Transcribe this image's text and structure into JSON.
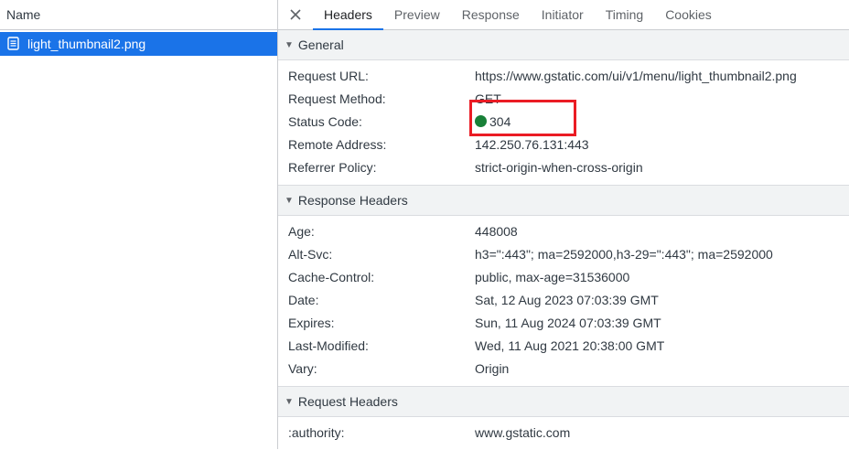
{
  "left": {
    "column_header": "Name",
    "request": {
      "name": "light_thumbnail2.png",
      "icon": "document-icon"
    }
  },
  "tabs": [
    "Headers",
    "Preview",
    "Response",
    "Initiator",
    "Timing",
    "Cookies"
  ],
  "active_tab": "Headers",
  "sections": {
    "general": {
      "title": "General",
      "rows": [
        {
          "key": "Request URL:",
          "value": "https://www.gstatic.com/ui/v1/menu/light_thumbnail2.png"
        },
        {
          "key": "Request Method:",
          "value": "GET"
        },
        {
          "key": "Status Code:",
          "value": "304"
        },
        {
          "key": "Remote Address:",
          "value": "142.250.76.131:443"
        },
        {
          "key": "Referrer Policy:",
          "value": "strict-origin-when-cross-origin"
        }
      ]
    },
    "response_headers": {
      "title": "Response Headers",
      "rows": [
        {
          "key": "Age:",
          "value": "448008"
        },
        {
          "key": "Alt-Svc:",
          "value": "h3=\":443\"; ma=2592000,h3-29=\":443\"; ma=2592000"
        },
        {
          "key": "Cache-Control:",
          "value": "public, max-age=31536000"
        },
        {
          "key": "Date:",
          "value": "Sat, 12 Aug 2023 07:03:39 GMT"
        },
        {
          "key": "Expires:",
          "value": "Sun, 11 Aug 2024 07:03:39 GMT"
        },
        {
          "key": "Last-Modified:",
          "value": "Wed, 11 Aug 2021 20:38:00 GMT"
        },
        {
          "key": "Vary:",
          "value": "Origin"
        }
      ]
    },
    "request_headers": {
      "title": "Request Headers",
      "rows": [
        {
          "key": ":authority:",
          "value": "www.gstatic.com"
        }
      ]
    }
  },
  "colors": {
    "accent": "#1a73e8",
    "status_ok": "#188038",
    "highlight": "#ea1c24"
  }
}
